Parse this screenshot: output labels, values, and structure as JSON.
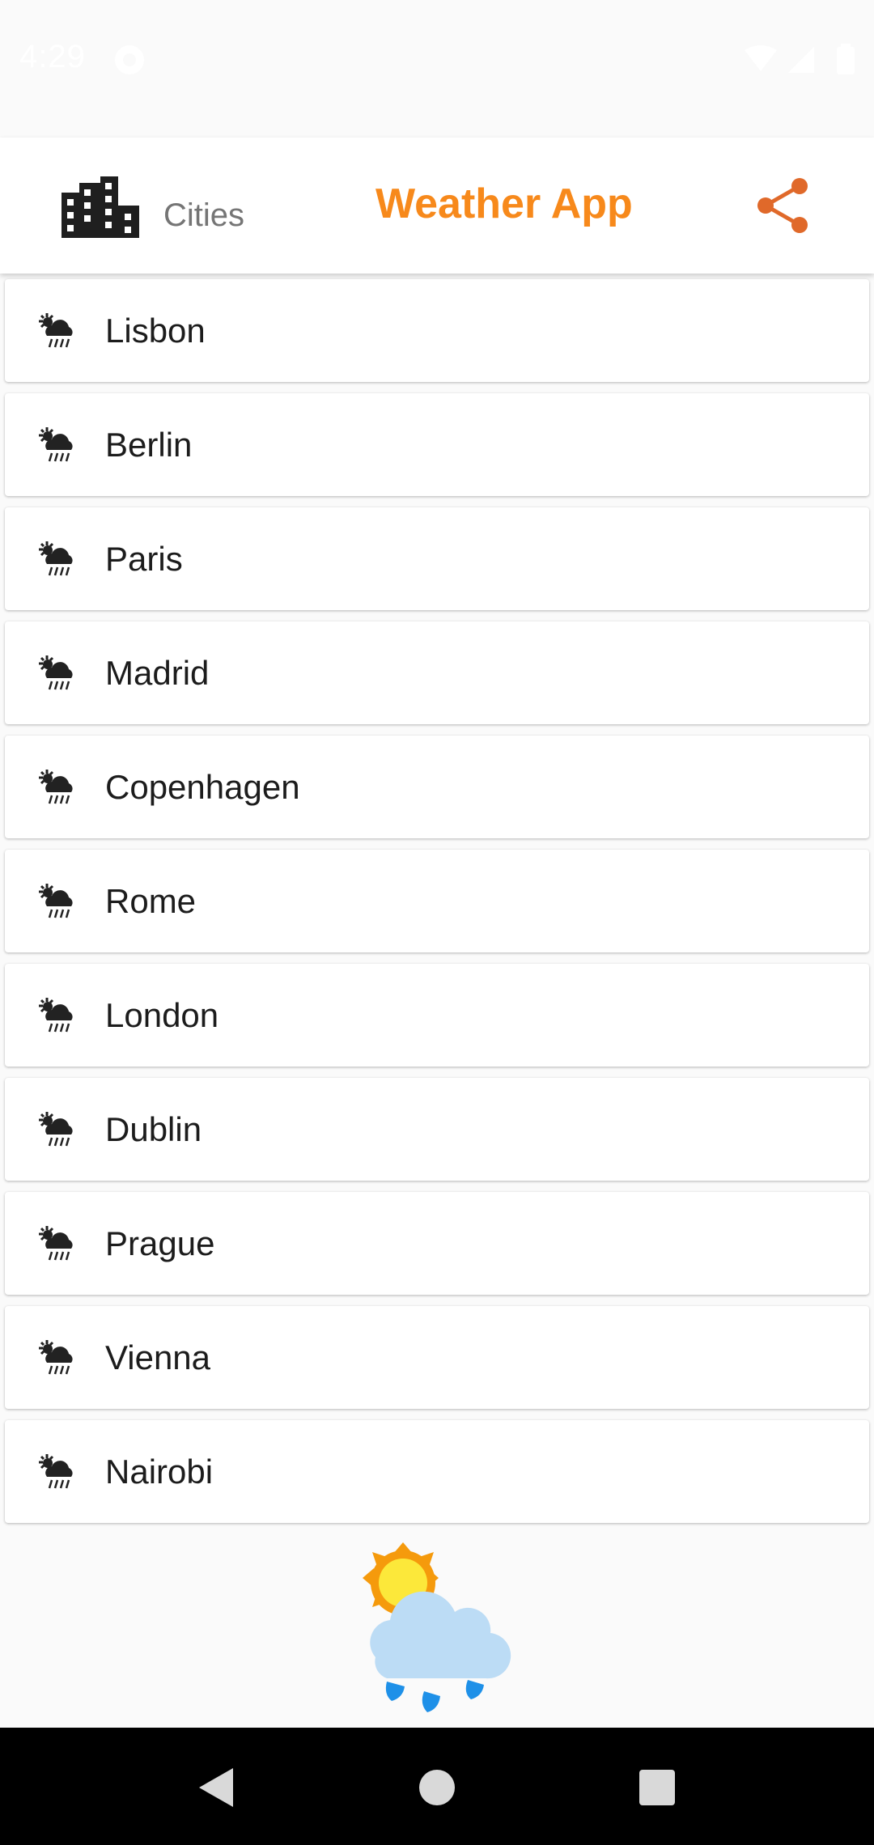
{
  "status_bar": {
    "time": "4:29",
    "icons": [
      "notification-icon",
      "wifi-icon",
      "signal-icon",
      "battery-icon"
    ]
  },
  "app_bar": {
    "cities_label": "Cities",
    "title": "Weather App",
    "icons": [
      "city-icon",
      "share-icon"
    ]
  },
  "cities": [
    {
      "name": "Lisbon",
      "icon": "sun-cloud-rain-icon"
    },
    {
      "name": "Berlin",
      "icon": "sun-cloud-rain-icon"
    },
    {
      "name": "Paris",
      "icon": "sun-cloud-rain-icon"
    },
    {
      "name": "Madrid",
      "icon": "sun-cloud-rain-icon"
    },
    {
      "name": "Copenhagen",
      "icon": "sun-cloud-rain-icon"
    },
    {
      "name": "Rome",
      "icon": "sun-cloud-rain-icon"
    },
    {
      "name": "London",
      "icon": "sun-cloud-rain-icon"
    },
    {
      "name": "Dublin",
      "icon": "sun-cloud-rain-icon"
    },
    {
      "name": "Prague",
      "icon": "sun-cloud-rain-icon"
    },
    {
      "name": "Vienna",
      "icon": "sun-cloud-rain-icon"
    },
    {
      "name": "Nairobi",
      "icon": "sun-cloud-rain-icon"
    }
  ],
  "illustration": {
    "icon": "weather-illustration-icon"
  },
  "nav_bar": {
    "icons": [
      "back-icon",
      "home-icon",
      "recents-icon"
    ]
  },
  "colors": {
    "accent": "#f7891b",
    "share": "#e0692a",
    "background": "#fafafa",
    "card": "#ffffff",
    "nav": "#000000"
  }
}
